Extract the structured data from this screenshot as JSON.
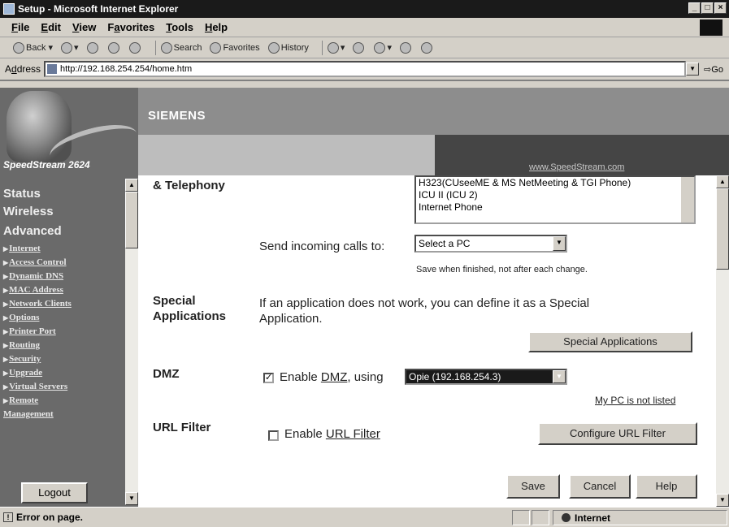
{
  "window": {
    "title": "Setup - Microsoft Internet Explorer",
    "buttons": [
      "_",
      "□",
      "×"
    ]
  },
  "menu": {
    "items": [
      {
        "prefix": "",
        "accel": "F",
        "rest": "ile"
      },
      {
        "prefix": "",
        "accel": "E",
        "rest": "dit"
      },
      {
        "prefix": "",
        "accel": "V",
        "rest": "iew"
      },
      {
        "prefix": "F",
        "accel": "a",
        "rest": "vorites"
      },
      {
        "prefix": "",
        "accel": "T",
        "rest": "ools"
      },
      {
        "prefix": "",
        "accel": "H",
        "rest": "elp"
      }
    ]
  },
  "toolbar": {
    "back": "Back",
    "search": "Search",
    "favorites": "Favorites",
    "history": "History"
  },
  "address": {
    "label": "Address",
    "accel": "d",
    "url": "http://192.168.254.254/home.htm",
    "go": "Go"
  },
  "banner": {
    "brand": "SpeedStream 2624",
    "company": "SIEMENS",
    "link": "www.SpeedStream.com"
  },
  "sidebar": {
    "main_items": [
      "Status",
      "Wireless",
      "Advanced"
    ],
    "sub_items": [
      "Internet",
      "Access Control",
      "Dynamic DNS",
      "MAC Address",
      "Network Clients",
      "Options",
      "Printer Port",
      "Routing",
      "Security",
      "Upgrade",
      "Virtual Servers",
      "Remote"
    ],
    "sub_continuation": "Management",
    "logout": "Logout"
  },
  "form": {
    "telephony_label": "& Telephony",
    "app_list": [
      "H323(CUseeME & MS NetMeeting & TGI Phone)",
      "ICU II (ICU 2)",
      "Internet Phone"
    ],
    "send_calls_label": "Send incoming calls to:",
    "send_calls_value": "Select a PC",
    "save_note": "Save when finished, not after each change.",
    "special_label_line1": "Special",
    "special_label_line2": "Applications",
    "special_desc_line1": "If an application does not work, you can define it as a Special",
    "special_desc_line2": "Application.",
    "special_button": "Special Applications",
    "dmz_label": "DMZ",
    "dmz_checked": true,
    "dmz_enable_prefix": "Enable ",
    "dmz_link": "DMZ",
    "dmz_enable_suffix": ", using",
    "dmz_select_value": "Opie (192.168.254.3)",
    "my_pc_link": "My PC is not listed",
    "url_label": "URL Filter",
    "url_checked": false,
    "url_enable_prefix": "Enable ",
    "url_link": "URL Filter",
    "url_button": "Configure URL Filter",
    "save_button": "Save",
    "cancel_button": "Cancel",
    "help_button": "Help"
  },
  "status": {
    "message": "Error on page.",
    "zone": "Internet"
  }
}
